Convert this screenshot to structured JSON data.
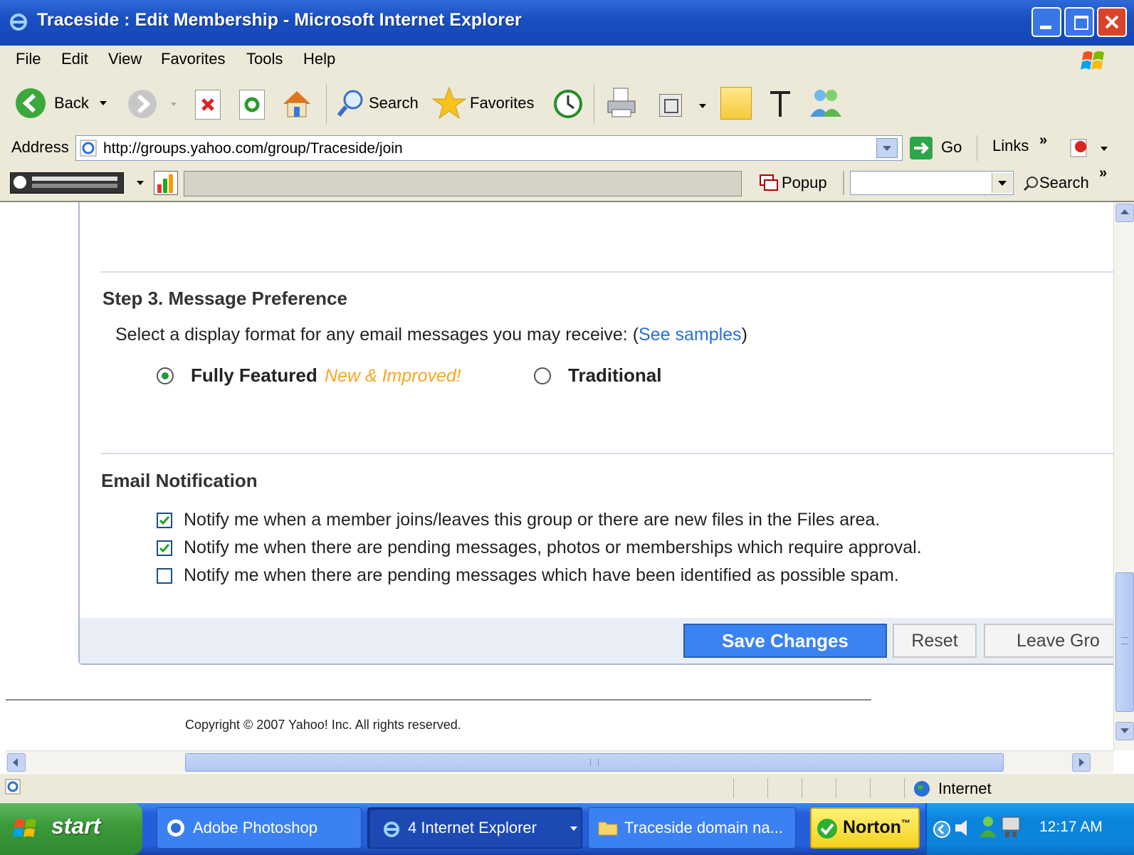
{
  "window": {
    "title": "Traceside : Edit Membership - Microsoft Internet Explorer"
  },
  "menu": [
    "File",
    "Edit",
    "View",
    "Favorites",
    "Tools",
    "Help"
  ],
  "toolbar": {
    "back": "Back",
    "search": "Search",
    "favorites": "Favorites"
  },
  "address": {
    "label": "Address",
    "url": "http://groups.yahoo.com/group/Traceside/join",
    "go": "Go",
    "links": "Links",
    "more": "»"
  },
  "toolbar2": {
    "popup": "Popup",
    "search": "Search",
    "more": "»"
  },
  "page": {
    "step3_heading": "Step 3. Message Preference",
    "format_prompt": "Select a display format for any email messages you may receive: (",
    "see_samples": "See samples",
    "format_prompt_close": ")",
    "options": [
      {
        "label": "Fully Featured",
        "tag": "New & Improved!",
        "selected": true
      },
      {
        "label": "Traditional",
        "selected": false
      }
    ],
    "email_heading": "Email Notification",
    "notifications": [
      {
        "label": "Notify me when a member joins/leaves this group or there are new files in the Files area.",
        "checked": true
      },
      {
        "label": "Notify me when there are pending messages, photos or memberships which require approval.",
        "checked": true
      },
      {
        "label": "Notify me when there are pending messages which have been identified as possible spam.",
        "checked": false
      }
    ],
    "buttons": {
      "save": "Save Changes",
      "reset": "Reset",
      "leave": "Leave Gro"
    },
    "copyright": "Copyright © 2007 Yahoo! Inc. All rights reserved."
  },
  "status": {
    "zone": "Internet"
  },
  "taskbar": {
    "start": "start",
    "tasks": [
      "Adobe Photoshop",
      "4 Internet Explorer",
      "Traceside domain na..."
    ],
    "norton": "Norton",
    "norton_mark": "™",
    "clock": "12:17 AM"
  },
  "colors": {
    "link": "#2b6fd6",
    "accent_orange": "#f5a623",
    "save_button": "#3b83f0"
  }
}
